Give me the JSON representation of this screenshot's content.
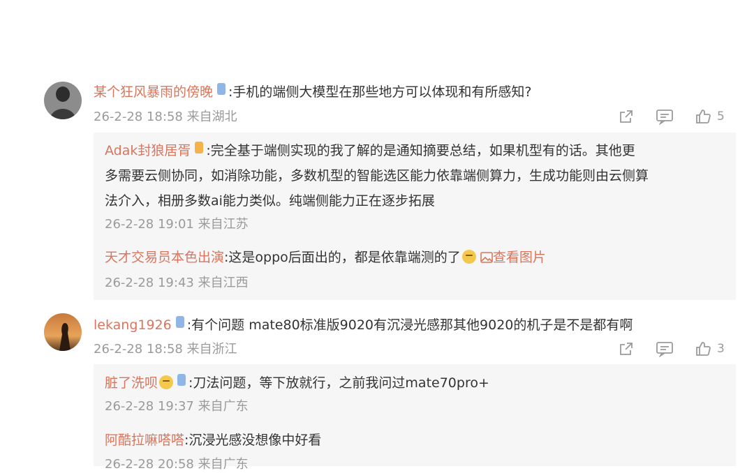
{
  "comments": [
    {
      "username": "某个狂风暴雨的傍晚",
      "badge": "",
      "text": ":手机的端侧大模型在那些地方可以体现和有所感知?",
      "meta": "26-2-28 18:58 来自湖北",
      "like_count": "5",
      "replies": [
        {
          "username": "Adak封狼居胥",
          "badge": "",
          "text_lines": [
            ":完全基于端侧实现的我了解的是通知摘要总结，如果机型有的话。其他更",
            "多需要云侧协同，如消除功能，多数机型的智能选区能力依靠端侧算力，生成功能则由云侧算",
            "法介入，相册多数ai能力类似。纯端侧能力正在逐步拓展"
          ],
          "meta": "26-2-28 19:01 来自江苏"
        },
        {
          "username": "天才交易员本色出演",
          "text": ":这是oppo后面出的，都是依靠端测的了",
          "view_image": "查看图片",
          "meta": "26-2-28 19:43 来自江西"
        }
      ]
    },
    {
      "username": "lekang1926",
      "badge": "",
      "text": ":有个问题 mate80标准版9020有沉浸光感那其他9020的机子是不是都有啊",
      "meta": "26-2-28 18:58 来自浙江",
      "like_count": "3",
      "replies": [
        {
          "username": "脏了洗呗",
          "badge": "",
          "text": ":刀法问题，等下放就行，之前我问过mate70pro+",
          "meta": "26-2-28 19:37 来自广东"
        },
        {
          "username": "阿酷拉嘛嗒嗒",
          "text": ":沉浸光感没想像中好看",
          "meta": "26-2-28 20:58 来自广东"
        }
      ]
    }
  ],
  "colors": {
    "username": "#d9755d",
    "meta": "#9a9a9a",
    "badge_blue": "#8fb6e6",
    "badge_orange": "#f3b24a",
    "reply_bg": "#f6f6f6"
  },
  "icons": [
    "share-icon",
    "comment-icon",
    "like-icon",
    "image-icon",
    "emoji-icon"
  ]
}
